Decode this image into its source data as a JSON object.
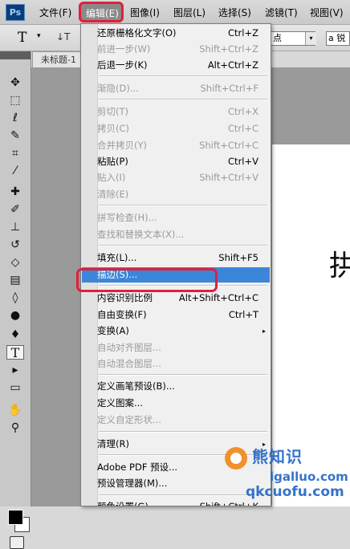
{
  "app": {
    "logo": "Ps"
  },
  "menubar": {
    "items": [
      "文件(F)",
      "编辑(E)",
      "图像(I)",
      "图层(L)",
      "选择(S)",
      "滤镜(T)",
      "视图(V)"
    ],
    "active": "编辑(E)"
  },
  "options_bar": {
    "tool_glyph": "T",
    "tool_arrow": "▾",
    "orient_glyph": "↓T",
    "font_size": "点",
    "font_size_drop": "▾",
    "antialias": "a 锐"
  },
  "document": {
    "tab_title": "未标题-1",
    "canvas_glyph": "拱"
  },
  "edit_menu": {
    "items": [
      {
        "label": "还原栅格化文字(O)",
        "shortcut": "Ctrl+Z",
        "disabled": false
      },
      {
        "label": "前进一步(W)",
        "shortcut": "Shift+Ctrl+Z",
        "disabled": true
      },
      {
        "label": "后退一步(K)",
        "shortcut": "Alt+Ctrl+Z",
        "disabled": false
      },
      {
        "label": "渐隐(D)...",
        "shortcut": "Shift+Ctrl+F",
        "disabled": true
      },
      {
        "label": "剪切(T)",
        "shortcut": "Ctrl+X",
        "disabled": true
      },
      {
        "label": "拷贝(C)",
        "shortcut": "Ctrl+C",
        "disabled": true
      },
      {
        "label": "合并拷贝(Y)",
        "shortcut": "Shift+Ctrl+C",
        "disabled": true
      },
      {
        "label": "粘贴(P)",
        "shortcut": "Ctrl+V",
        "disabled": false
      },
      {
        "label": "贴入(I)",
        "shortcut": "Shift+Ctrl+V",
        "disabled": true
      },
      {
        "label": "清除(E)",
        "shortcut": "",
        "disabled": true
      },
      {
        "label": "拼写检查(H)...",
        "shortcut": "",
        "disabled": true
      },
      {
        "label": "查找和替换文本(X)...",
        "shortcut": "",
        "disabled": true
      },
      {
        "label": "填充(L)...",
        "shortcut": "Shift+F5",
        "disabled": false
      },
      {
        "label": "描边(S)...",
        "shortcut": "",
        "disabled": false,
        "highlighted": true
      },
      {
        "label": "内容识别比例",
        "shortcut": "Alt+Shift+Ctrl+C",
        "disabled": false
      },
      {
        "label": "自由变换(F)",
        "shortcut": "Ctrl+T",
        "disabled": false
      },
      {
        "label": "变换(A)",
        "shortcut": "",
        "disabled": false,
        "submenu": true,
        "arrow": "▸"
      },
      {
        "label": "自动对齐图层...",
        "shortcut": "",
        "disabled": true
      },
      {
        "label": "自动混合图层...",
        "shortcut": "",
        "disabled": true
      },
      {
        "label": "定义画笔预设(B)...",
        "shortcut": "",
        "disabled": false
      },
      {
        "label": "定义图案...",
        "shortcut": "",
        "disabled": false
      },
      {
        "label": "定义自定形状...",
        "shortcut": "",
        "disabled": true
      },
      {
        "label": "清理(R)",
        "shortcut": "",
        "disabled": false,
        "submenu": true,
        "arrow": "▸"
      },
      {
        "label": "Adobe PDF 预设...",
        "shortcut": "",
        "disabled": false
      },
      {
        "label": "预设管理器(M)...",
        "shortcut": "",
        "disabled": false
      },
      {
        "label": "颜色设置(G)...",
        "shortcut": "Shift+Ctrl+K",
        "disabled": false
      }
    ]
  },
  "toolbox": {
    "tools": [
      {
        "name": "move-tool-icon",
        "glyph": "✥"
      },
      {
        "name": "marquee-tool-icon",
        "glyph": "⬚"
      },
      {
        "name": "lasso-tool-icon",
        "glyph": "ℓ"
      },
      {
        "name": "quick-selection-tool-icon",
        "glyph": "✎"
      },
      {
        "name": "crop-tool-icon",
        "glyph": "⌗"
      },
      {
        "name": "eyedropper-tool-icon",
        "glyph": "⁄"
      },
      {
        "name": "healing-brush-tool-icon",
        "glyph": "✚"
      },
      {
        "name": "brush-tool-icon",
        "glyph": "✐"
      },
      {
        "name": "clone-stamp-tool-icon",
        "glyph": "⊥"
      },
      {
        "name": "history-brush-tool-icon",
        "glyph": "↺"
      },
      {
        "name": "eraser-tool-icon",
        "glyph": "◇"
      },
      {
        "name": "gradient-tool-icon",
        "glyph": "▤"
      },
      {
        "name": "blur-tool-icon",
        "glyph": "◊"
      },
      {
        "name": "dodge-tool-icon",
        "glyph": "●"
      },
      {
        "name": "pen-tool-icon",
        "glyph": "♦"
      },
      {
        "name": "type-tool-icon",
        "glyph": "T"
      },
      {
        "name": "path-selection-tool-icon",
        "glyph": "▸"
      },
      {
        "name": "shape-tool-icon",
        "glyph": "▭"
      },
      {
        "name": "hand-tool-icon",
        "glyph": "✋"
      },
      {
        "name": "zoom-tool-icon",
        "glyph": "⚲"
      }
    ]
  },
  "watermark": {
    "line1": "熊知识",
    "line2": "igalluo.com",
    "line3": "qkcuofu.com"
  },
  "colors": {
    "highlight": "#3b86d9",
    "annotation": "#e0203a",
    "disabled": "#9a9a9a"
  }
}
